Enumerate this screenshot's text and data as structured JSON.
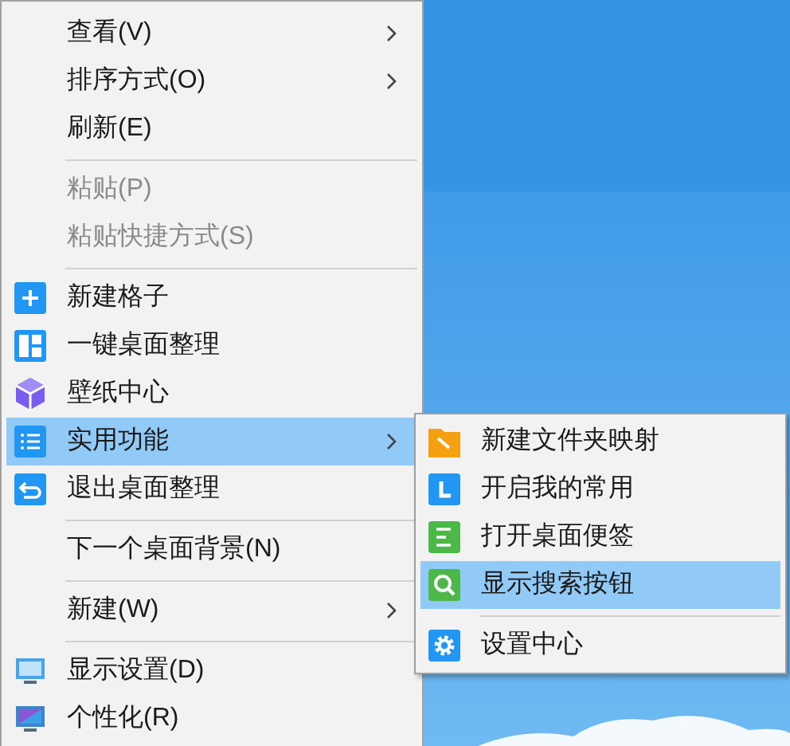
{
  "context_menu": {
    "items": [
      {
        "kind": "item",
        "label": "查看(V)",
        "disabled": false,
        "selected": false,
        "has_submenu": true
      },
      {
        "kind": "item",
        "label": "排序方式(O)",
        "disabled": false,
        "selected": false,
        "has_submenu": true
      },
      {
        "kind": "item",
        "label": "刷新(E)",
        "disabled": false,
        "selected": false,
        "has_submenu": false
      },
      {
        "kind": "separator"
      },
      {
        "kind": "item",
        "label": "粘贴(P)",
        "disabled": true,
        "selected": false,
        "has_submenu": false
      },
      {
        "kind": "item",
        "label": "粘贴快捷方式(S)",
        "disabled": true,
        "selected": false,
        "has_submenu": false
      },
      {
        "kind": "separator"
      },
      {
        "kind": "item",
        "label": "新建格子",
        "disabled": false,
        "selected": false,
        "has_submenu": false
      },
      {
        "kind": "item",
        "label": "一键桌面整理",
        "disabled": false,
        "selected": false,
        "has_submenu": false
      },
      {
        "kind": "item",
        "label": "壁纸中心",
        "disabled": false,
        "selected": false,
        "has_submenu": false
      },
      {
        "kind": "item",
        "label": "实用功能",
        "disabled": false,
        "selected": true,
        "has_submenu": true
      },
      {
        "kind": "item",
        "label": "退出桌面整理",
        "disabled": false,
        "selected": false,
        "has_submenu": false
      },
      {
        "kind": "separator"
      },
      {
        "kind": "item",
        "label": "下一个桌面背景(N)",
        "disabled": false,
        "selected": false,
        "has_submenu": false
      },
      {
        "kind": "separator"
      },
      {
        "kind": "item",
        "label": "新建(W)",
        "disabled": false,
        "selected": false,
        "has_submenu": true
      },
      {
        "kind": "separator"
      },
      {
        "kind": "item",
        "label": "显示设置(D)",
        "disabled": false,
        "selected": false,
        "has_submenu": false
      },
      {
        "kind": "item",
        "label": "个性化(R)",
        "disabled": false,
        "selected": false,
        "has_submenu": false
      }
    ]
  },
  "submenu": {
    "items": [
      {
        "kind": "item",
        "label": "新建文件夹映射",
        "selected": false
      },
      {
        "kind": "item",
        "label": "开启我的常用",
        "selected": false
      },
      {
        "kind": "item",
        "label": "打开桌面便签",
        "selected": false
      },
      {
        "kind": "item",
        "label": "显示搜索按钮",
        "selected": true
      },
      {
        "kind": "separator"
      },
      {
        "kind": "item",
        "label": "设置中心",
        "selected": false
      }
    ]
  }
}
